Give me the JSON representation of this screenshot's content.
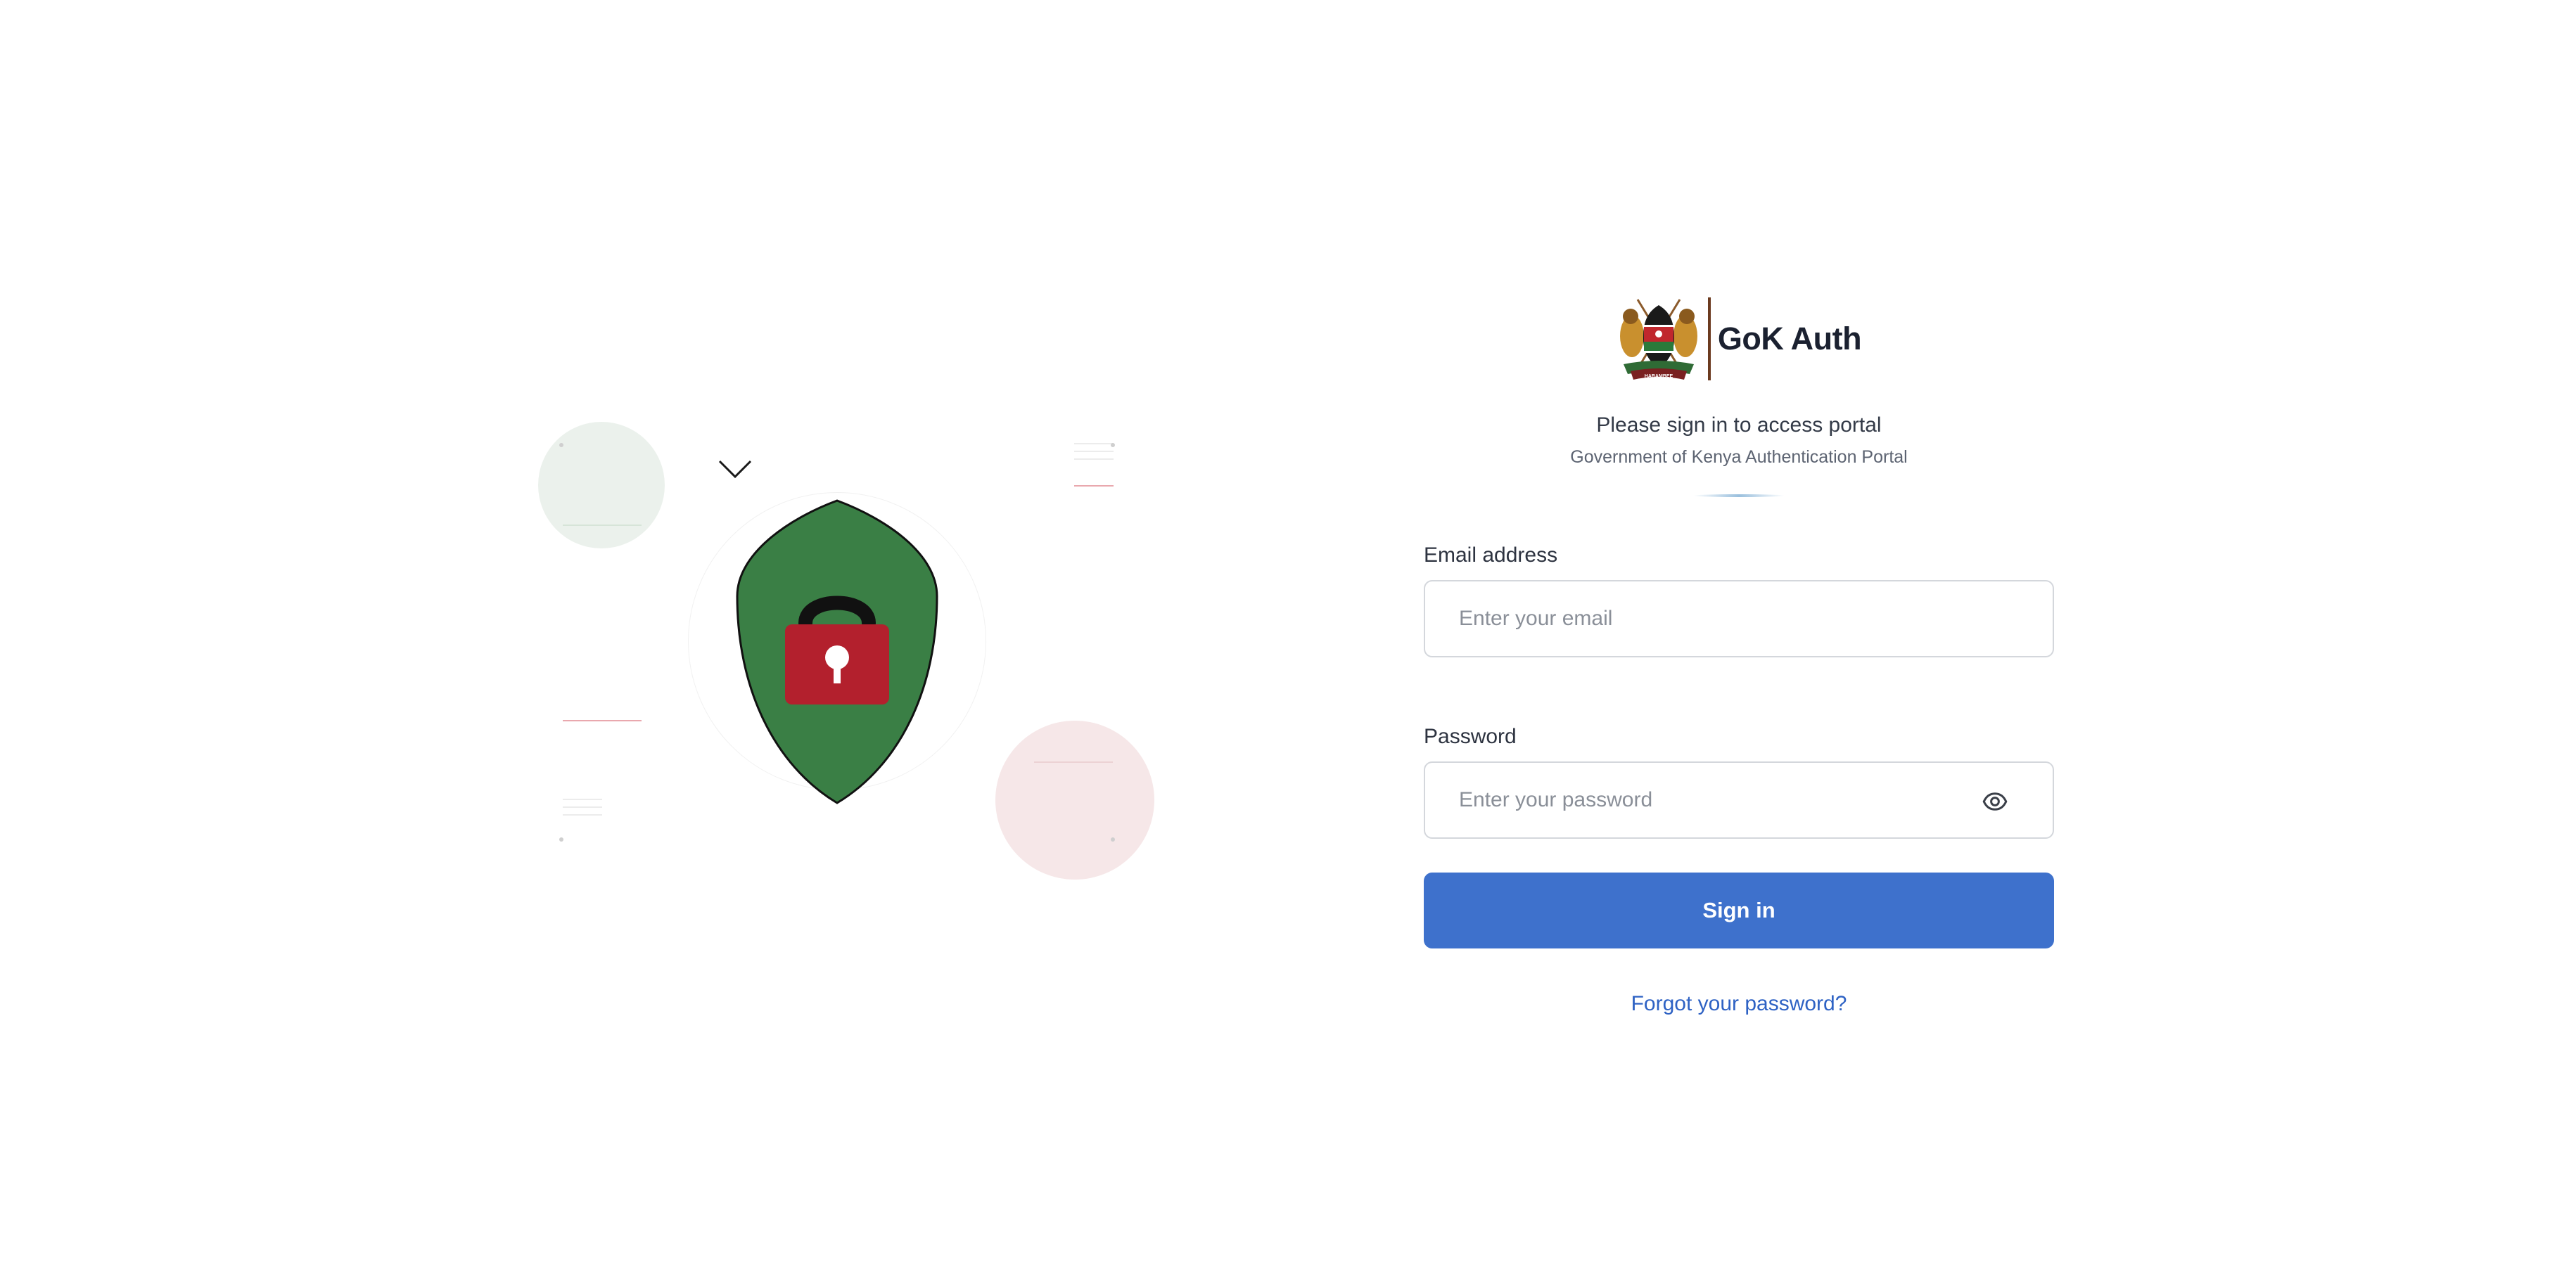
{
  "brand": {
    "name": "GoK Auth",
    "logo_lettering": "HARAMBEE"
  },
  "heading": {
    "title": "Please sign in to access portal",
    "subtitle": "Government of Kenya Authentication Portal"
  },
  "form": {
    "email": {
      "label": "Email address",
      "value": "",
      "placeholder": "Enter your email"
    },
    "password": {
      "label": "Password",
      "value": "",
      "placeholder": "Enter your password",
      "toggle_icon": "eye-icon"
    },
    "submit_label": "Sign in",
    "forgot_label": "Forgot your password?"
  },
  "illustration": {
    "icons": [
      "shield-icon",
      "padlock-icon",
      "chevron-down-icon"
    ]
  },
  "colors": {
    "primary": "#3e71cc",
    "link": "#2e62c4",
    "shield_green": "#3a7f45",
    "lock_red": "#b3202d",
    "brand_text": "#1b2130"
  }
}
